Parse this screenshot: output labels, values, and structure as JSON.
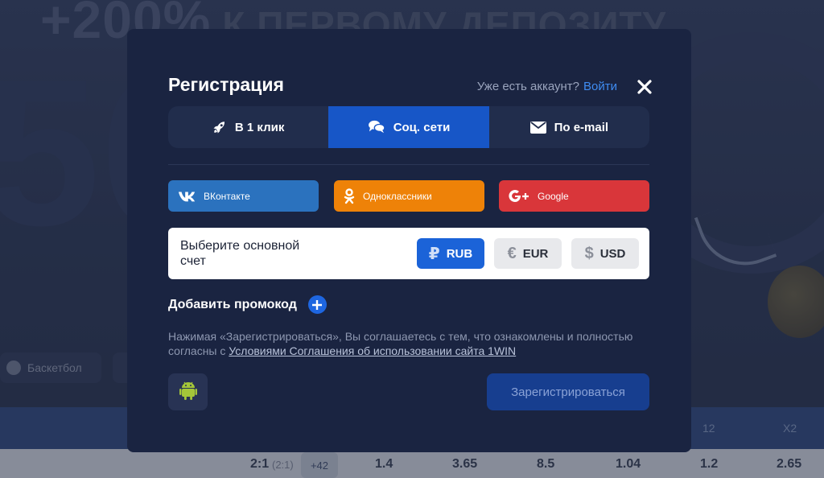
{
  "background": {
    "banner_big": "+200%",
    "banner_text": "К ПЕРВОМУ ДЕПОЗИТУ",
    "big_number": "50",
    "sport_chip": "Баскетбол",
    "table_headers": [
      "12",
      "X2"
    ],
    "row": {
      "score": "2:1",
      "score_half": "(2:1)",
      "more_markets": "+42",
      "odds": [
        "1.4",
        "3.65",
        "8.5",
        "1.04",
        "1.2",
        "2.65"
      ]
    }
  },
  "modal": {
    "title": "Регистрация",
    "have_account": "Уже есть аккаунт?",
    "login_link": "Войти",
    "tabs": [
      {
        "label": "В 1 клик",
        "icon": "rocket-icon",
        "active": false
      },
      {
        "label": "Соц. сети",
        "icon": "chat-bubbles-icon",
        "active": true
      },
      {
        "label": "По e-mail",
        "icon": "envelope-icon",
        "active": false
      }
    ],
    "social": {
      "vk": "ВКонтакте",
      "ok": "Одноклассники",
      "google": "Google"
    },
    "account": {
      "label": "Выберите основной счет",
      "currencies": [
        {
          "code": "RUB",
          "symbol": "₽",
          "selected": true
        },
        {
          "code": "EUR",
          "symbol": "€",
          "selected": false
        },
        {
          "code": "USD",
          "symbol": "$",
          "selected": false
        }
      ]
    },
    "promo_label": "Добавить промокод",
    "terms_text": "Нажимая «Зарегистрироваться», Вы соглашаетесь с тем, что ознакомлены и полностью согласны с",
    "terms_link": "Условиями Соглашения об использовании сайта 1WIN",
    "register_button": "Зарегистрироваться"
  },
  "colors": {
    "modal_bg": "#1a2441",
    "active_tab": "#1756c7",
    "vk": "#2b72be",
    "ok": "#ee8208",
    "google": "#d9363a",
    "link": "#3f8cf2",
    "android": "#a4c639"
  }
}
